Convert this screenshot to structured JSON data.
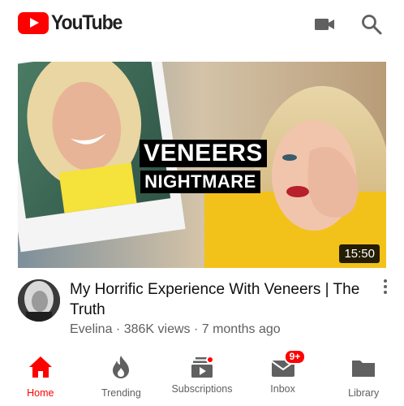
{
  "header": {
    "brand": "YouTube",
    "icons": [
      "youtube-logo-icon",
      "video-camera-icon",
      "search-icon"
    ]
  },
  "video": {
    "thumbnail_text_line1": "VENEERS",
    "thumbnail_text_line2": "NIGHTMARE",
    "duration": "15:50",
    "title": "My Horrific Experience With Veneers | The Truth",
    "channel": "Evelina",
    "views": "386K views",
    "age": "7 months ago",
    "subtitle": "Evelina · 386K views · 7 months ago"
  },
  "nav": {
    "items": [
      {
        "label": "Home",
        "icon": "home-icon",
        "active": true
      },
      {
        "label": "Trending",
        "icon": "fire-icon",
        "active": false
      },
      {
        "label": "Subscriptions",
        "icon": "subscriptions-icon",
        "active": false
      },
      {
        "label": "Inbox",
        "icon": "inbox-icon",
        "active": false,
        "badge": "9+"
      },
      {
        "label": "Library",
        "icon": "folder-icon",
        "active": false
      }
    ]
  },
  "colors": {
    "brand_red": "#ff0000",
    "text_primary": "#0f0f0f",
    "text_secondary": "#606060",
    "icon_gray": "#606060"
  }
}
